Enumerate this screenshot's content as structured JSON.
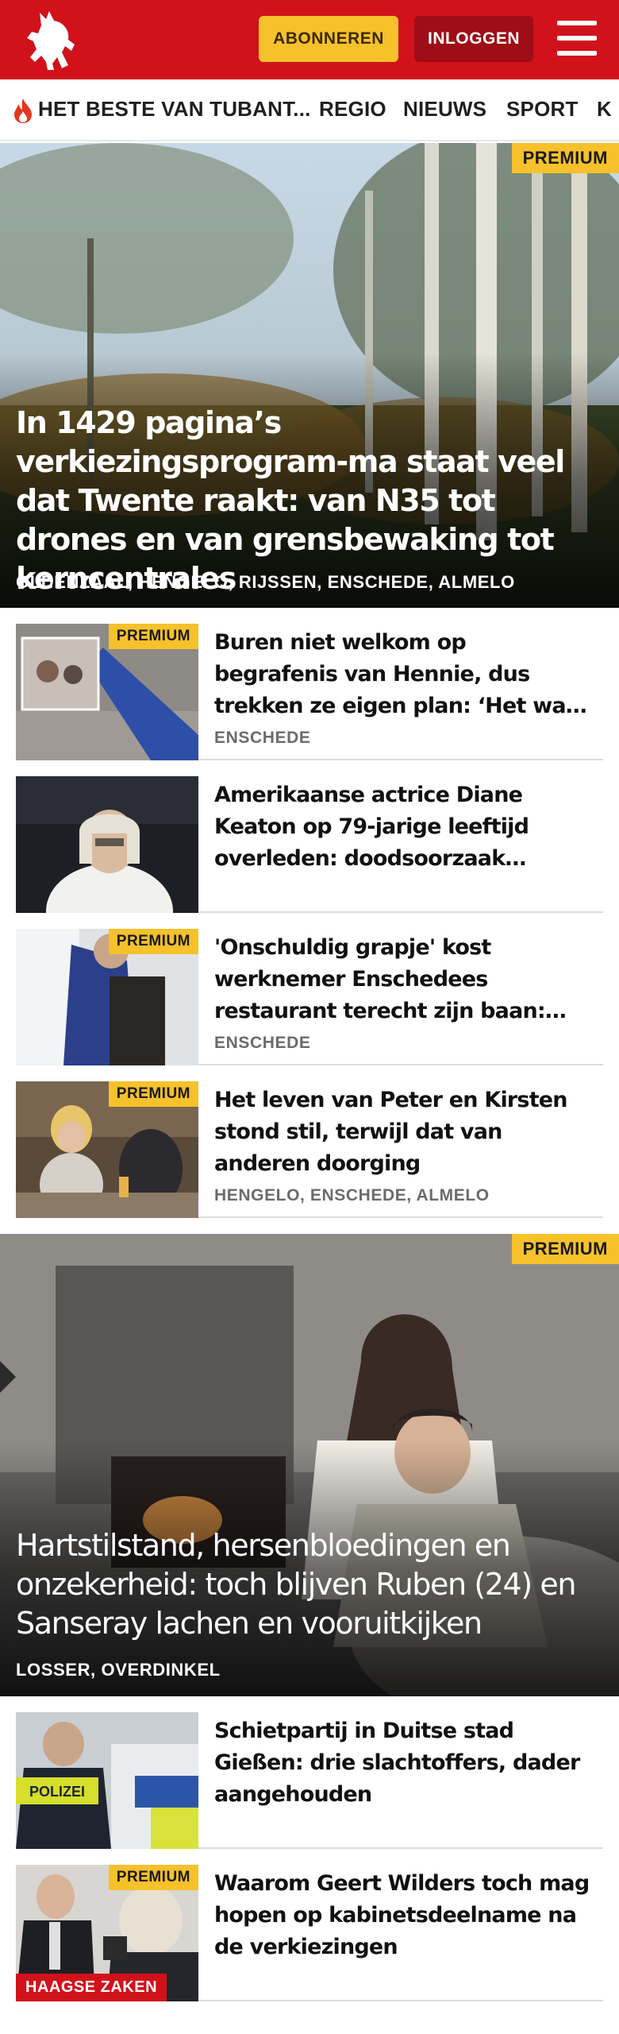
{
  "header": {
    "brand_color": "#d1121b",
    "logo_icon": "horse-logo-icon",
    "subscribe_label": "ABONNEREN",
    "login_label": "INLOGGEN",
    "menu_icon": "hamburger-menu-icon"
  },
  "nav": {
    "items": [
      "HET BESTE VAN TUBANT...",
      "REGIO",
      "NIEUWS",
      "SPORT",
      "K"
    ]
  },
  "premium_label": "PREMIUM",
  "hero1": {
    "title": "In 1429 pagina’s verkiezingsprogram-ma staat veel dat Twente raakt: van N35 tot drones en van grensbewaking tot kerncentrales",
    "locations": "OLDENZAAL, HENGELO, RIJSSEN, ENSCHEDE, ALMELO"
  },
  "articles1": [
    {
      "title": "Buren niet welkom op begrafenis van Hennie, dus trekken ze eigen plan: ‘Het was een tweede…",
      "location": "ENSCHEDE",
      "premium": true
    },
    {
      "title": "Amerikaanse actrice Diane Keaton op 79-jarige leeftijd overleden: doodsoorzaak…",
      "location": "",
      "premium": false
    },
    {
      "title": "'Onschuldig grapje' kost werknemer Enschedees restaurant terecht zijn baan: 'Hi…",
      "location": "ENSCHEDE",
      "premium": true
    },
    {
      "title": "Het leven van Peter en Kirsten stond stil, terwijl dat van anderen doorging",
      "location": "HENGELO, ENSCHEDE, ALMELO",
      "premium": true
    }
  ],
  "hero2": {
    "title": "Hartstilstand, hersenbloedingen en onzekerheid: toch blijven Ruben (24) en Sanseray lachen en vooruitkijken",
    "locations": "LOSSER, OVERDINKEL"
  },
  "articles2": [
    {
      "title": "Schietpartij in Duitse stad Gießen: drie slachtoffers, dader aangehouden",
      "location": "",
      "premium": false,
      "thumb_text": "POLIZEI"
    },
    {
      "title": "Waarom Geert Wilders toch mag hopen op kabinetsdeelname na de verkiezingen",
      "location": "",
      "premium": true,
      "section_tag": "HAAGSE ZAKEN"
    }
  ]
}
